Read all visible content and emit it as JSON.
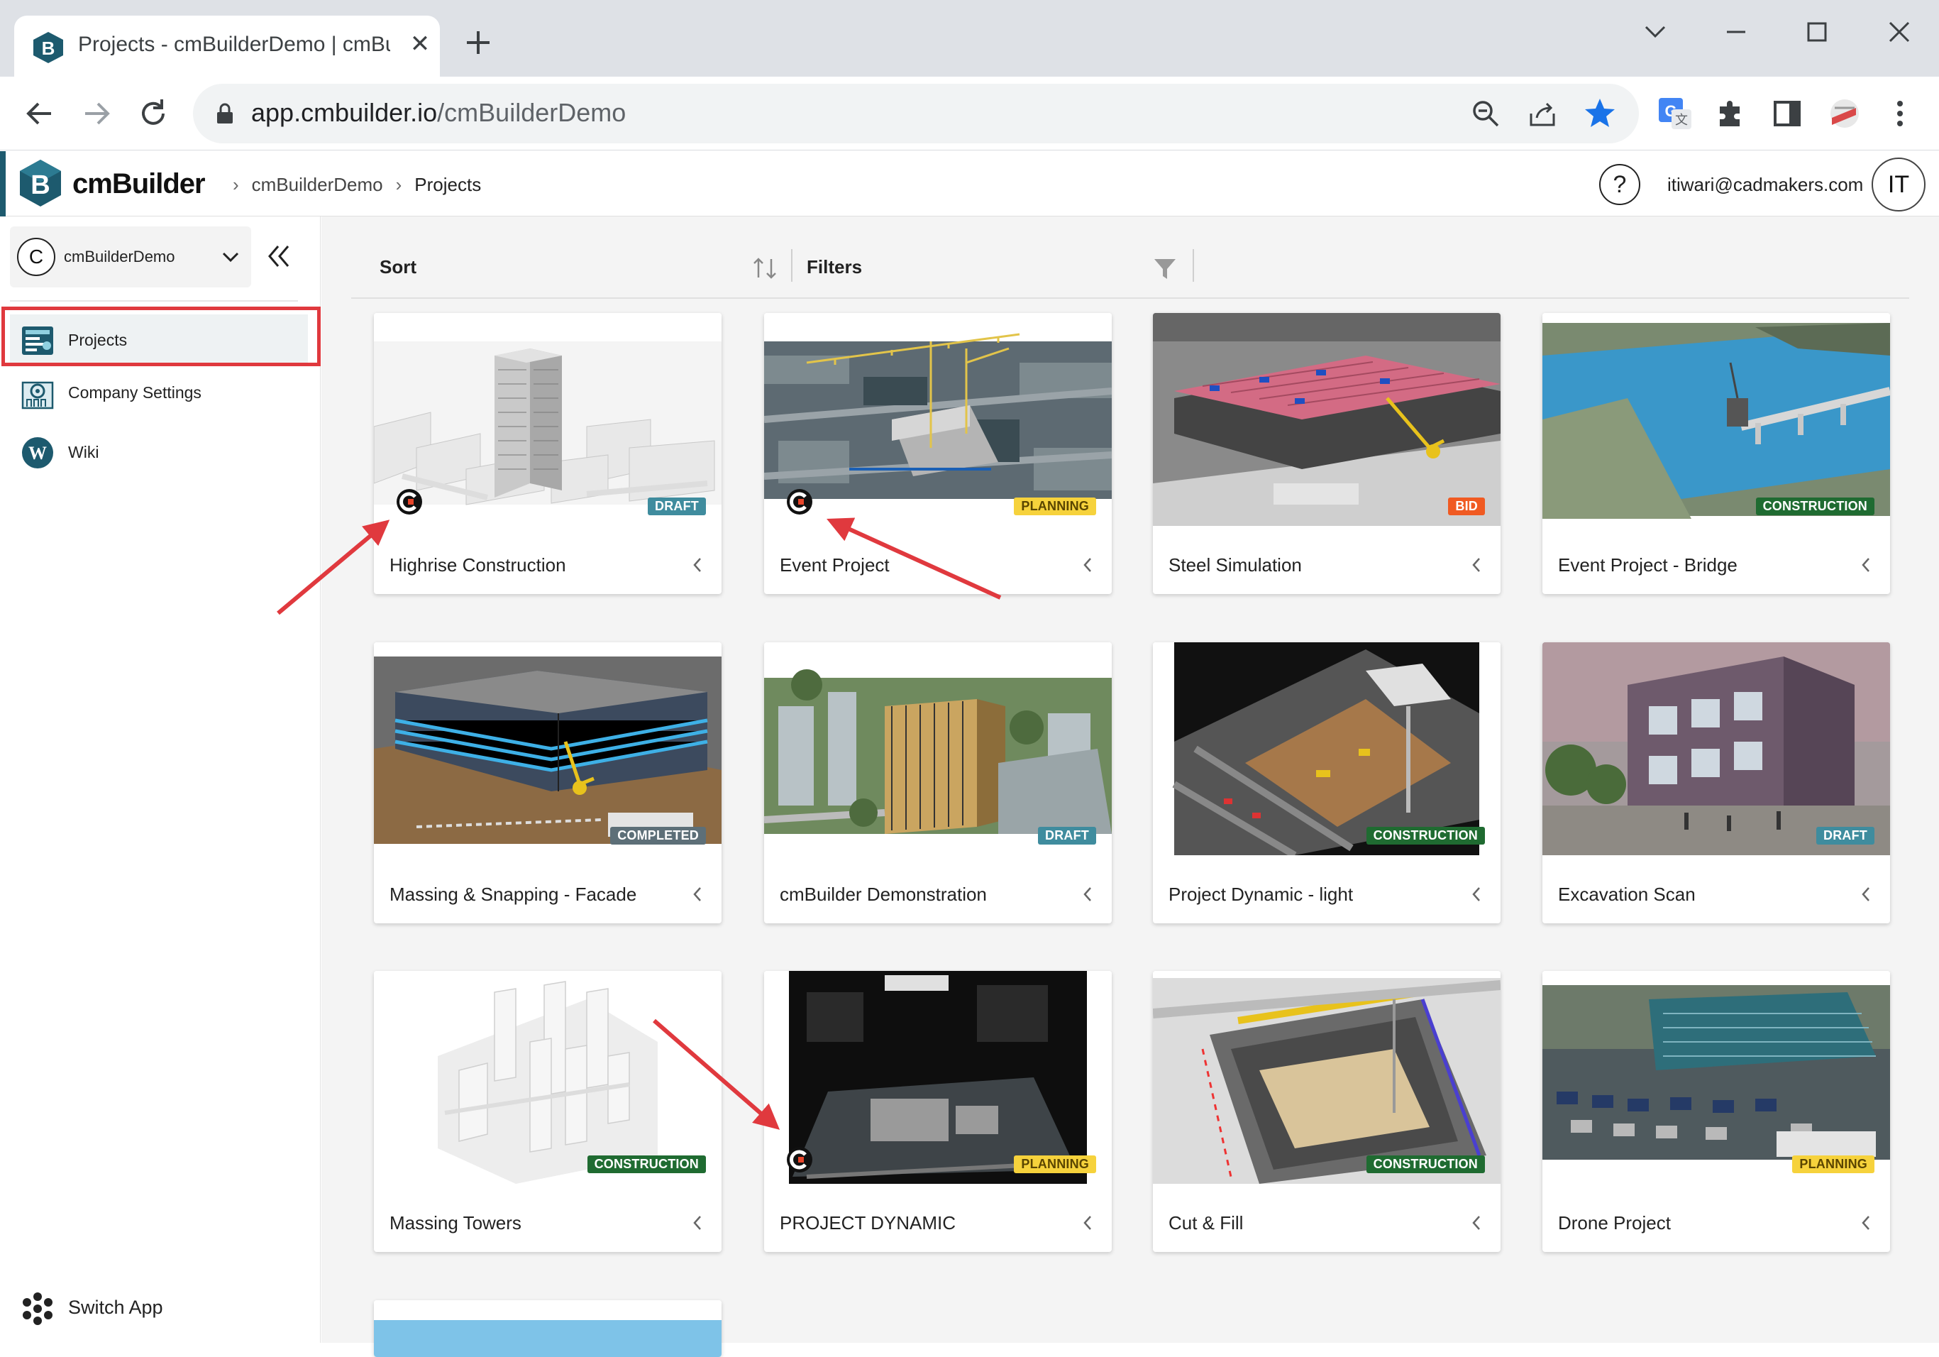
{
  "browser": {
    "tab_title": "Projects - cmBuilderDemo | cmBu",
    "url_host": "app.cmbuilder.io",
    "url_path": "/cmBuilderDemo"
  },
  "header": {
    "logo_text": "cmBuilder",
    "breadcrumb": [
      "cmBuilderDemo",
      "Projects"
    ],
    "help_label": "?",
    "user_email": "itiwari@cadmakers.com",
    "user_initials": "IT"
  },
  "sidebar": {
    "org_initial": "C",
    "org_name": "cmBuilderDemo",
    "items": [
      {
        "label": "Projects",
        "icon": "projects-icon"
      },
      {
        "label": "Company Settings",
        "icon": "company-settings-icon"
      },
      {
        "label": "Wiki",
        "icon": "wiki-icon"
      }
    ],
    "switch_app_label": "Switch App"
  },
  "toolbar": {
    "sort_label": "Sort",
    "filters_label": "Filters"
  },
  "projects": [
    {
      "name": "Highrise Construction",
      "status": "DRAFT"
    },
    {
      "name": "Event Project",
      "status": "PLANNING"
    },
    {
      "name": "Steel Simulation",
      "status": "BID"
    },
    {
      "name": "Event Project - Bridge",
      "status": "CONSTRUCTION"
    },
    {
      "name": "Massing & Snapping - Facade",
      "status": "COMPLETED"
    },
    {
      "name": "cmBuilder Demonstration",
      "status": "DRAFT"
    },
    {
      "name": "Project Dynamic - light",
      "status": "CONSTRUCTION"
    },
    {
      "name": "Excavation Scan",
      "status": "DRAFT"
    },
    {
      "name": "Massing Towers",
      "status": "CONSTRUCTION"
    },
    {
      "name": "PROJECT DYNAMIC",
      "status": "PLANNING"
    },
    {
      "name": "Cut & Fill",
      "status": "CONSTRUCTION"
    },
    {
      "name": "Drone Project",
      "status": "PLANNING"
    }
  ],
  "colors": {
    "highlight": "#e0393e",
    "brand": "#1d5a6e",
    "draft": "#3f8c9e",
    "planning": "#f6d23c",
    "bid": "#f05a22",
    "construction": "#1f6b31",
    "completed": "#5d6f78"
  }
}
